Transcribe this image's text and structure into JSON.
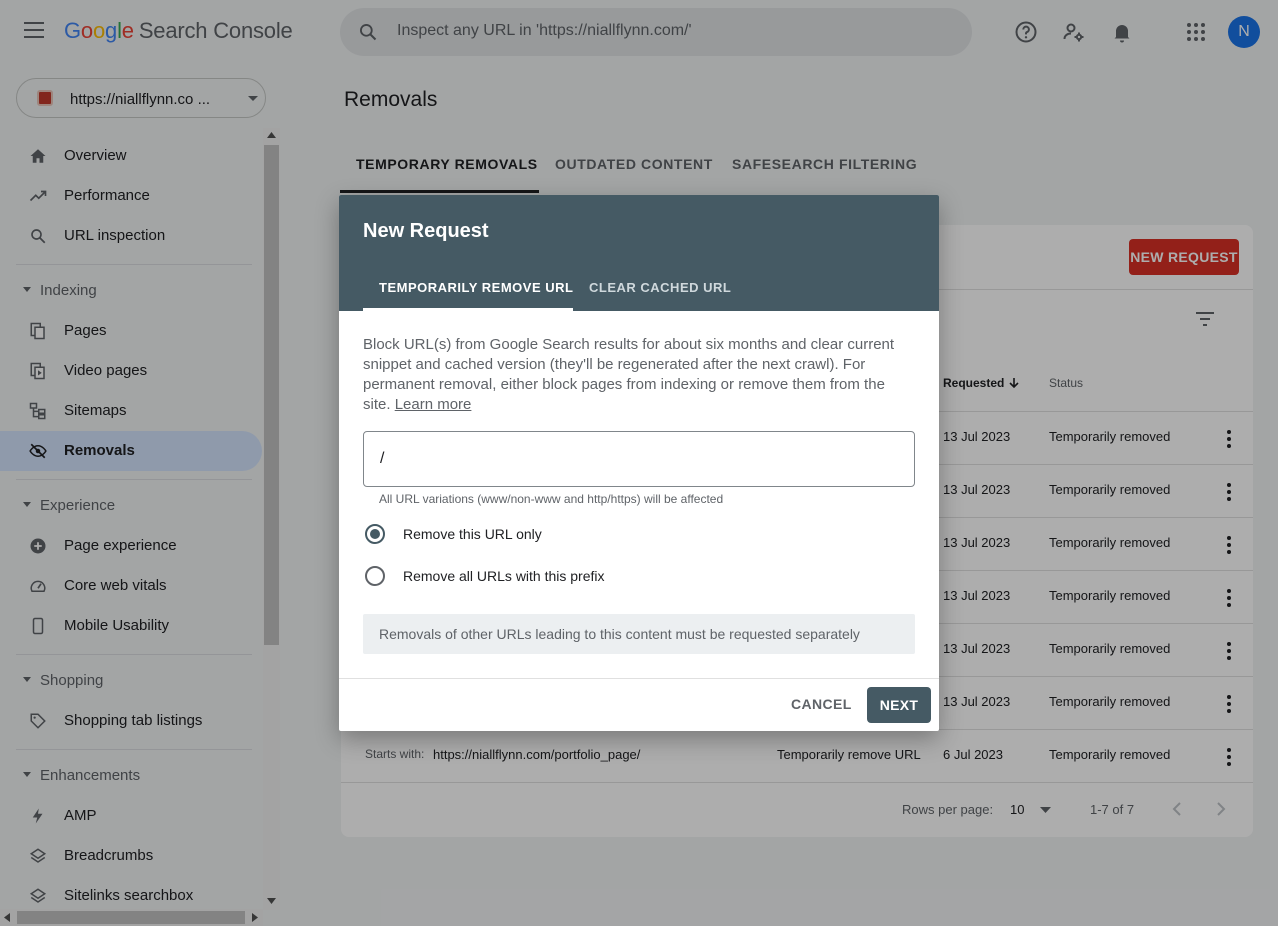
{
  "header": {
    "logo_google": [
      "G",
      "o",
      "o",
      "g",
      "l",
      "e"
    ],
    "product_name": "Search Console",
    "search_placeholder": "Inspect any URL in 'https://niallflynn.com/'",
    "avatar_letter": "N"
  },
  "sidebar": {
    "property": "https://niallflynn.co ...",
    "top_items": [
      {
        "label": "Overview",
        "icon": "home-icon"
      },
      {
        "label": "Performance",
        "icon": "trending-up-icon"
      },
      {
        "label": "URL inspection",
        "icon": "search-icon"
      }
    ],
    "sections": [
      {
        "label": "Indexing",
        "items": [
          {
            "label": "Pages",
            "icon": "pages-icon"
          },
          {
            "label": "Video pages",
            "icon": "video-pages-icon"
          },
          {
            "label": "Sitemaps",
            "icon": "sitemap-icon"
          },
          {
            "label": "Removals",
            "icon": "visibility-off-icon",
            "active": true
          }
        ]
      },
      {
        "label": "Experience",
        "items": [
          {
            "label": "Page experience",
            "icon": "plus-circle-icon"
          },
          {
            "label": "Core web vitals",
            "icon": "speed-gauge-icon"
          },
          {
            "label": "Mobile Usability",
            "icon": "smartphone-icon"
          }
        ]
      },
      {
        "label": "Shopping",
        "items": [
          {
            "label": "Shopping tab listings",
            "icon": "tag-icon"
          }
        ]
      },
      {
        "label": "Enhancements",
        "items": [
          {
            "label": "AMP",
            "icon": "bolt-icon"
          },
          {
            "label": "Breadcrumbs",
            "icon": "layers-icon"
          },
          {
            "label": "Sitelinks searchbox",
            "icon": "layers-icon"
          }
        ]
      }
    ]
  },
  "main": {
    "title": "Removals",
    "tabs": [
      "TEMPORARY REMOVALS",
      "OUTDATED CONTENT",
      "SAFESEARCH FILTERING"
    ],
    "new_request_label": "NEW REQUEST",
    "columns": {
      "requested": "Requested",
      "status": "Status"
    },
    "rows": [
      {
        "requested": "13 Jul 2023",
        "status": "Temporarily removed"
      },
      {
        "requested": "13 Jul 2023",
        "status": "Temporarily removed"
      },
      {
        "requested": "13 Jul 2023",
        "status": "Temporarily removed"
      },
      {
        "requested": "13 Jul 2023",
        "status": "Temporarily removed"
      },
      {
        "requested": "13 Jul 2023",
        "status": "Temporarily removed"
      },
      {
        "requested": "13 Jul 2023",
        "status": "Temporarily removed"
      },
      {
        "prefix": "Starts with:",
        "url": "https://niallflynn.com/portfolio_page/",
        "type": "Temporarily remove URL",
        "requested": "6 Jul 2023",
        "status": "Temporarily removed"
      }
    ],
    "pagination": {
      "rows_per_page_label": "Rows per page:",
      "rows_per_page": "10",
      "range": "1-7 of 7"
    }
  },
  "dialog": {
    "title": "New Request",
    "tabs": [
      "TEMPORARILY REMOVE URL",
      "CLEAR CACHED URL"
    ],
    "description": "Block URL(s) from Google Search results for about six months and clear current snippet and cached version (they'll be regenerated after the next crawl). For permanent removal, either block pages from indexing or remove them from the site.",
    "learn_more": "Learn more",
    "url_value": "/",
    "hint": "All URL variations (www/non-www and http/https) will be affected",
    "options": [
      "Remove this URL only",
      "Remove all URLs with this prefix"
    ],
    "note": "Removals of other URLs leading to this content must be requested separately",
    "cancel_label": "CANCEL",
    "next_label": "NEXT"
  }
}
